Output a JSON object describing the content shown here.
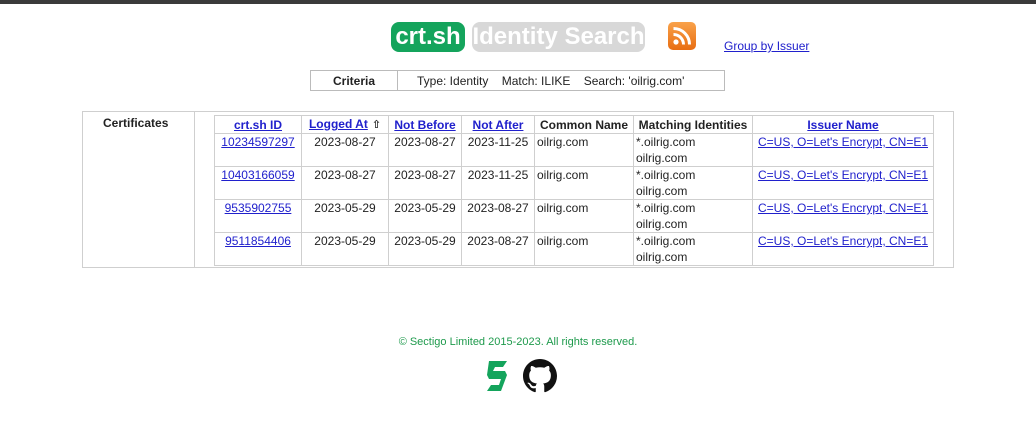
{
  "header": {
    "logo_primary": "crt.sh",
    "logo_secondary": "Identity Search",
    "rss_icon": "rss-feed-icon",
    "group_link": "Group by Issuer"
  },
  "criteria": {
    "label": "Criteria",
    "value": "Type: Identity    Match: ILIKE    Search: 'oilrig.com'"
  },
  "section_label": "Certificates",
  "table": {
    "headers": {
      "id": "crt.sh ID",
      "logged_at": "Logged At",
      "logged_at_sort_icon": "⇧",
      "not_before": "Not Before",
      "not_after": "Not After",
      "common_name": "Common Name",
      "matching": "Matching Identities",
      "issuer": "Issuer Name"
    },
    "rows": [
      {
        "id": "10234597297",
        "logged_at": "2023-08-27",
        "not_before": "2023-08-27",
        "not_after": "2023-11-25",
        "common_name": "oilrig.com",
        "matching_1": "*.oilrig.com",
        "matching_2": "oilrig.com",
        "issuer": "C=US, O=Let's Encrypt, CN=E1"
      },
      {
        "id": "10403166059",
        "logged_at": "2023-08-27",
        "not_before": "2023-08-27",
        "not_after": "2023-11-25",
        "common_name": "oilrig.com",
        "matching_1": "*.oilrig.com",
        "matching_2": "oilrig.com",
        "issuer": "C=US, O=Let's Encrypt, CN=E1"
      },
      {
        "id": "9535902755",
        "logged_at": "2023-05-29",
        "not_before": "2023-05-29",
        "not_after": "2023-08-27",
        "common_name": "oilrig.com",
        "matching_1": "*.oilrig.com",
        "matching_2": "oilrig.com",
        "issuer": "C=US, O=Let's Encrypt, CN=E1"
      },
      {
        "id": "9511854406",
        "logged_at": "2023-05-29",
        "not_before": "2023-05-29",
        "not_after": "2023-08-27",
        "common_name": "oilrig.com",
        "matching_1": "*.oilrig.com",
        "matching_2": "oilrig.com",
        "issuer": "C=US, O=Let's Encrypt, CN=E1"
      }
    ]
  },
  "footer": {
    "copyright": "© Sectigo Limited 2015-2023. All rights reserved.",
    "icons": [
      "sectigo-logo-icon",
      "github-icon"
    ]
  },
  "colors": {
    "brand_green": "#14a45c",
    "link_blue": "#2020cc",
    "rss_orange": "#f28a2c"
  }
}
